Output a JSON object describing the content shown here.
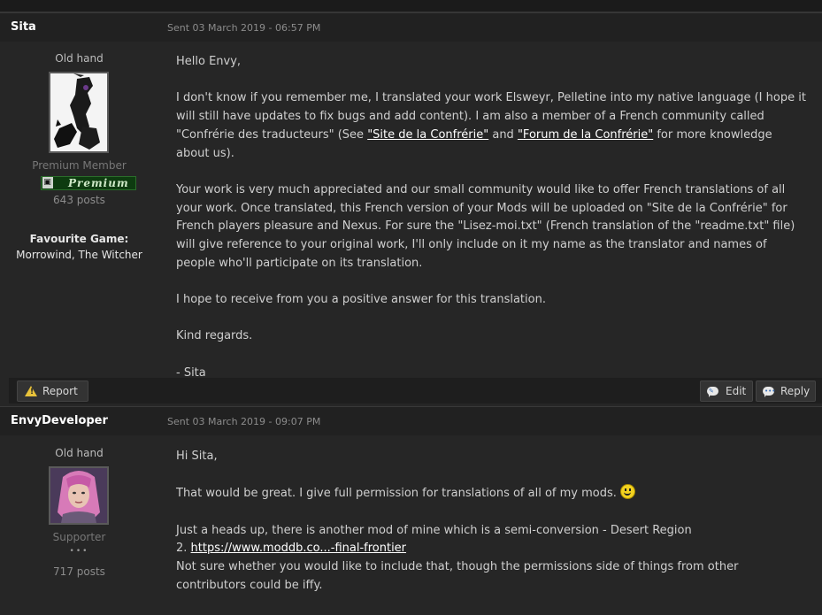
{
  "posts": [
    {
      "author": "Sita",
      "sent": "Sent 03 March 2019 - 06:57 PM",
      "rank": "Old hand",
      "member_group": "Premium Member",
      "badge_label": "Premium",
      "post_count": "643 posts",
      "favourite_game_label": "Favourite Game:",
      "favourite_game_value": "Morrowind, The Witcher",
      "body": {
        "greeting": "Hello Envy,",
        "p1_start": "I don't know if you remember me, I translated your work Elsweyr, Pelletine into my native language (I hope it will still have updates to fix bugs and add content). I am also a member of a French community called \"Confrérie des traducteurs\" (See ",
        "link1": "\"Site de la Confrérie\"",
        "p1_mid": " and ",
        "link2": "\"Forum de la Confrérie\"",
        "p1_end": " for more knowledge about us).",
        "p2": "Your work is very much appreciated and our small community would like to offer French translations of all your work. Once translated, this French version of your Mods will be uploaded on \"Site de la Confrérie\" for French players pleasure and Nexus. For sure the \"Lisez-moi.txt\" (French translation of the \"readme.txt\" file) will give reference to your original work, I'll only include on it my name as the translator and names of people who'll participate on its translation.",
        "p3": "I hope to receive from you a positive answer for this translation.",
        "p4": "Kind regards.",
        "p5": "- Sita"
      },
      "actions": {
        "report": "Report",
        "edit": "Edit",
        "reply": "Reply"
      }
    },
    {
      "author": "EnvyDeveloper",
      "sent": "Sent 03 March 2019 - 09:07 PM",
      "rank": "Old hand",
      "member_group": "Supporter",
      "pips": "•••",
      "post_count": "717 posts",
      "body": {
        "greeting": "Hi Sita,",
        "p1": "That would be great. I give full permission for translations of all of my mods.",
        "p2": "Just a heads up, there is another mod of mine which is a semi-conversion - Desert Region",
        "p2_prefix": "2. ",
        "link": "https://www.moddb.co...-final-frontier",
        "p3": "Not sure whether you would like to include that, though the permissions side of things from other contributors could be iffy."
      }
    }
  ],
  "icons": {
    "report": "warning-icon",
    "edit": "edit-bubble-icon",
    "reply": "reply-bubble-icon",
    "smiley": "smiley-emoticon"
  },
  "colors": {
    "background": "#262626",
    "header": "#212121",
    "badge_bg": "#0e3b10",
    "link": "#ffffff",
    "warning": "#e8c23a"
  }
}
